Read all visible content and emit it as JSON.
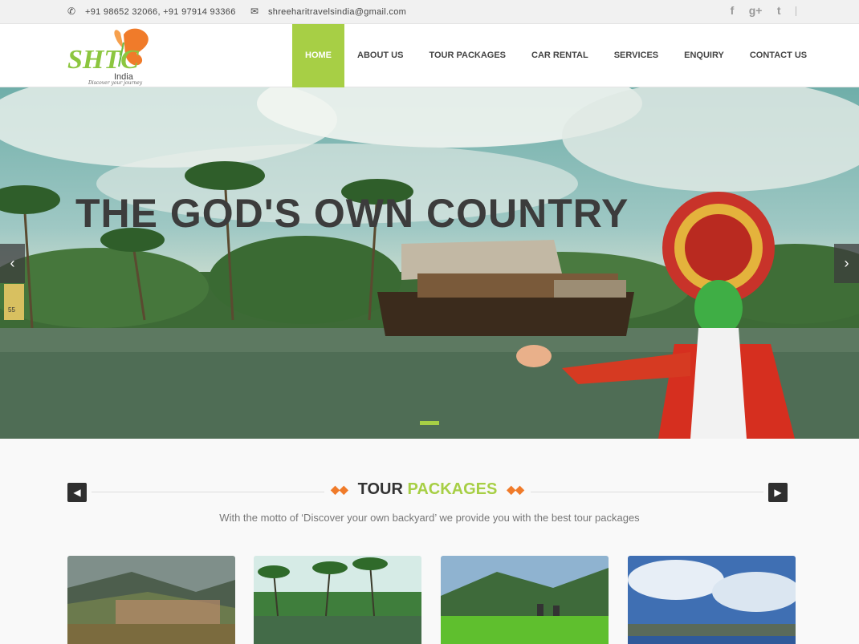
{
  "topbar": {
    "phone": "+91 98652 32066, +91 97914 93366",
    "email": "shreeharitravelsindia@gmail.com",
    "social": [
      "f",
      "g+",
      "t"
    ]
  },
  "logo": {
    "main": "SHTC",
    "sub": "India",
    "tagline": "Discover your journey"
  },
  "nav": [
    {
      "label": "HOME",
      "active": true
    },
    {
      "label": "ABOUT US"
    },
    {
      "label": "TOUR PACKAGES"
    },
    {
      "label": "CAR RENTAL"
    },
    {
      "label": "SERVICES"
    },
    {
      "label": "ENQUIRY"
    },
    {
      "label": "CONTACT US"
    }
  ],
  "hero": {
    "title": "THE GOD'S OWN COUNTRY",
    "prev": "‹",
    "next": "›",
    "sign": "55"
  },
  "section": {
    "title_a": "TOUR",
    "title_b": "PACKAGES",
    "prev": "◀",
    "next": "▶",
    "subtitle": "With the motto of ‘Discover your own backyard’ we provide you with the best tour packages"
  },
  "colors": {
    "accent": "#a7cf45",
    "orange": "#f07b2a",
    "dark": "#2f2f2f"
  }
}
